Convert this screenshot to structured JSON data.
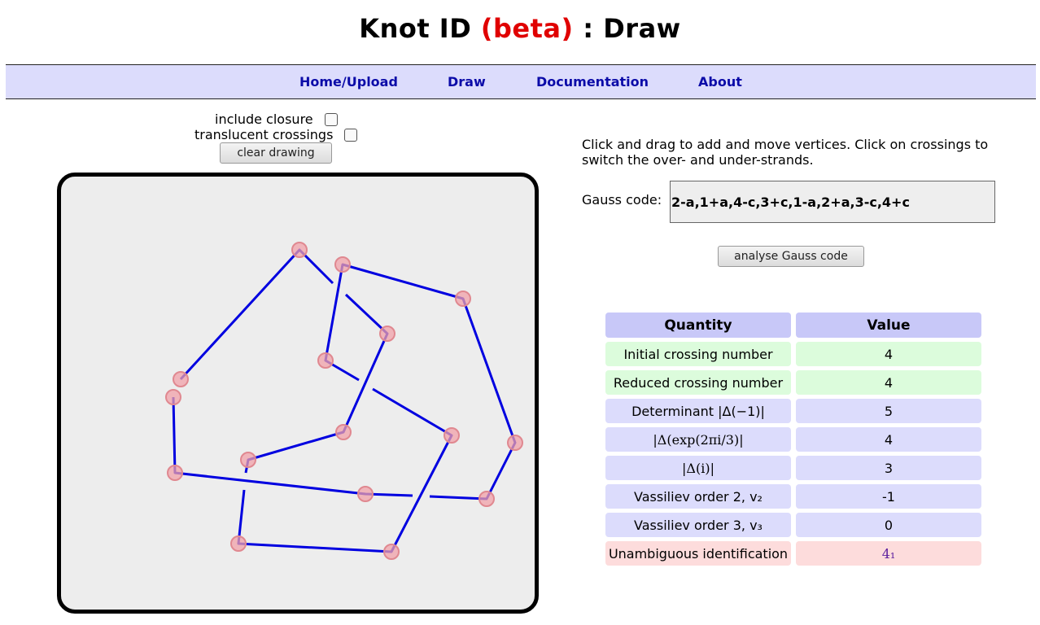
{
  "header": {
    "title_main": "Knot ID",
    "title_beta": "(beta)",
    "title_rest": ": Draw"
  },
  "nav": {
    "items": [
      "Home/Upload",
      "Draw",
      "Documentation",
      "About"
    ]
  },
  "options": {
    "closure_label": "include closure",
    "closure_checked": false,
    "translucent_label": "translucent crossings",
    "translucent_checked": false,
    "clear_button": "clear drawing"
  },
  "instructions": "Click and drag to add and move vertices. Click on crossings to switch the over- and under-strands.",
  "gauss": {
    "label": "Gauss code:",
    "value": "2-a,1+a,4-c,3+c,1-a,2+a,3-c,4+c",
    "analyse_button": "analyse Gauss code"
  },
  "results": {
    "headers": [
      "Quantity",
      "Value"
    ],
    "rows": [
      {
        "quantity": "Initial crossing number",
        "value": "4",
        "color": "green"
      },
      {
        "quantity": "Reduced crossing number",
        "value": "4",
        "color": "green"
      },
      {
        "quantity": "Determinant |Δ(−1)|",
        "value": "5",
        "color": "blue"
      },
      {
        "quantity": "|Δ(exp(2πi/3)|",
        "value": "4",
        "color": "blue"
      },
      {
        "quantity": "|Δ(i)|",
        "value": "3",
        "color": "blue"
      },
      {
        "quantity": "Vassiliev order 2, v₂",
        "value": "-1",
        "color": "blue"
      },
      {
        "quantity": "Vassiliev order 3, v₃",
        "value": "0",
        "color": "blue"
      },
      {
        "quantity": "Unambiguous identification",
        "value": "4₁",
        "color": "red"
      }
    ]
  },
  "colors": {
    "strand": "#0000e0",
    "vertex": "#f0a0a8",
    "nav_bg": "#dcdcfc",
    "beta": "#e00000"
  }
}
